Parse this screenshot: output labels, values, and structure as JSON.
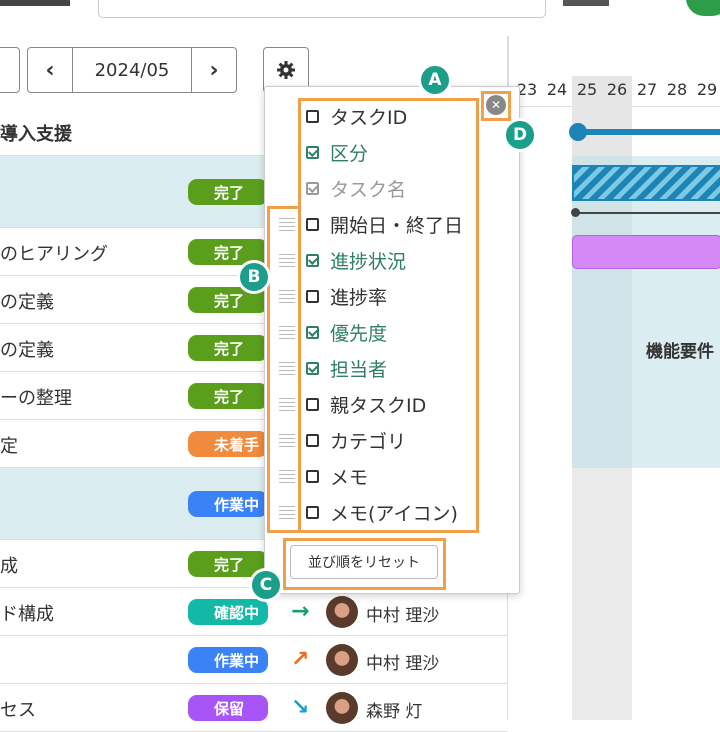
{
  "toolbar": {
    "date": "2024/05",
    "prev": "‹",
    "next": "›"
  },
  "project_title": "導入支援",
  "tasks": [
    {
      "name": "",
      "status": "完了"
    },
    {
      "name": "のヒアリング",
      "status": "完了"
    },
    {
      "name": "の定義",
      "status": "完了"
    },
    {
      "name": "の定義",
      "status": "完了"
    },
    {
      "name": "ーの整理",
      "status": "完了"
    },
    {
      "name": "定",
      "status": "未着手"
    },
    {
      "name": "",
      "status": "作業中"
    },
    {
      "name": "成",
      "status": "完了"
    },
    {
      "name": "ド構成",
      "status": "確認中"
    },
    {
      "name": "",
      "status": "作業中"
    },
    {
      "name": "セス",
      "status": "保留"
    }
  ],
  "assignees": [
    {
      "name": "中村 理沙",
      "priority_icon": "arrow-right-icon"
    },
    {
      "name": "中村 理沙",
      "priority_icon": "arrow-up-right-icon"
    },
    {
      "name": "森野 灯",
      "priority_icon": "arrow-down-right-icon"
    }
  ],
  "status_colors": {
    "完了": "#5a9e1c",
    "未着手": "#f08a3c",
    "作業中": "#3b82f6",
    "確認中": "#14b8a6",
    "保留": "#a855f7"
  },
  "gantt": {
    "days": [
      "23",
      "24",
      "25",
      "26",
      "27",
      "28",
      "29"
    ],
    "bar_label": "機能要件"
  },
  "column_menu": {
    "items": [
      {
        "label": "タスクID",
        "checked": false,
        "disabled": false
      },
      {
        "label": "区分",
        "checked": true,
        "disabled": false
      },
      {
        "label": "タスク名",
        "checked": true,
        "disabled": true
      },
      {
        "label": "開始日・終了日",
        "checked": false,
        "disabled": false
      },
      {
        "label": "進捗状況",
        "checked": true,
        "disabled": false
      },
      {
        "label": "進捗率",
        "checked": false,
        "disabled": false
      },
      {
        "label": "優先度",
        "checked": true,
        "disabled": false
      },
      {
        "label": "担当者",
        "checked": true,
        "disabled": false
      },
      {
        "label": "親タスクID",
        "checked": false,
        "disabled": false
      },
      {
        "label": "カテゴリ",
        "checked": false,
        "disabled": false
      },
      {
        "label": "メモ",
        "checked": false,
        "disabled": false
      },
      {
        "label": "メモ(アイコン)",
        "checked": false,
        "disabled": false
      }
    ],
    "reset_label": "並び順をリセット"
  },
  "markers": {
    "a": "A",
    "b": "B",
    "c": "C",
    "d": "D"
  },
  "colors": {
    "highlight": "#f0a04b",
    "marker": "#1b9e8a",
    "checked_text": "#2f7f62"
  }
}
